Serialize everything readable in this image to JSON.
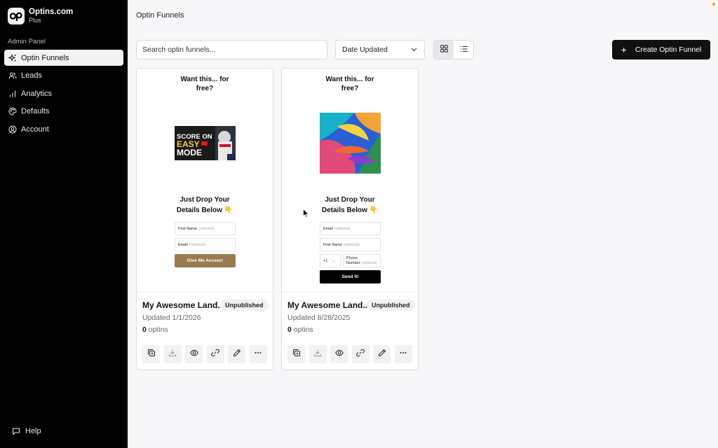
{
  "sidebar": {
    "brand_name": "Optins.com",
    "brand_plan": "Plus",
    "section_label": "Admin Panel",
    "items": [
      {
        "label": "Optin Funnels",
        "icon": "sparkles-icon",
        "active": true
      },
      {
        "label": "Leads",
        "icon": "users-icon"
      },
      {
        "label": "Analytics",
        "icon": "bar-chart-icon"
      },
      {
        "label": "Defaults",
        "icon": "palette-icon"
      },
      {
        "label": "Account",
        "icon": "user-circle-icon"
      }
    ],
    "help_label": "Help"
  },
  "header": {
    "title": "Optin Funnels"
  },
  "toolbar": {
    "search_placeholder": "Search optin funnels...",
    "sort_value": "Date Updated",
    "view_modes": [
      "grid",
      "list"
    ],
    "active_view": "grid",
    "create_label": "Create Optin Funnel"
  },
  "cards": [
    {
      "preview": {
        "headline_1": "Want this... for",
        "headline_2": "free?",
        "sub_1": "Just Drop Your",
        "sub_2": "Details Below 👇",
        "fields": [
          {
            "label": "First Name",
            "opt": "(optional)"
          },
          {
            "label": "Email",
            "opt": "(optional)"
          }
        ],
        "button": "Give Me Access!",
        "button_color": "#9a7a4f",
        "image_text_1": "SCORE ON",
        "image_text_2": "EASY",
        "image_text_3": "MODE"
      },
      "title": "My Awesome Land...",
      "status": "Unpublished",
      "updated": "Updated 1/1/2026",
      "optins_count": "0",
      "optins_label": "optins"
    },
    {
      "preview": {
        "headline_1": "Want this... for",
        "headline_2": "free?",
        "sub_1": "Just Drop Your",
        "sub_2": "Details Below 👇",
        "fields": [
          {
            "label": "Email",
            "opt": "(optional)"
          },
          {
            "label": "First Name",
            "opt": "(optional)"
          }
        ],
        "phone_code": "+1",
        "phone_label_1": "Phone",
        "phone_label_2": "Number",
        "phone_opt": "(optional)",
        "button": "Send it!",
        "button_color": "#000000"
      },
      "title": "My Awesome Land...",
      "status": "Unpublished",
      "updated": "Updated 8/28/2025",
      "optins_count": "0",
      "optins_label": "optins"
    }
  ],
  "card_actions": [
    "duplicate-icon",
    "download-icon",
    "eye-icon",
    "link-icon",
    "pencil-icon",
    "more-icon"
  ]
}
